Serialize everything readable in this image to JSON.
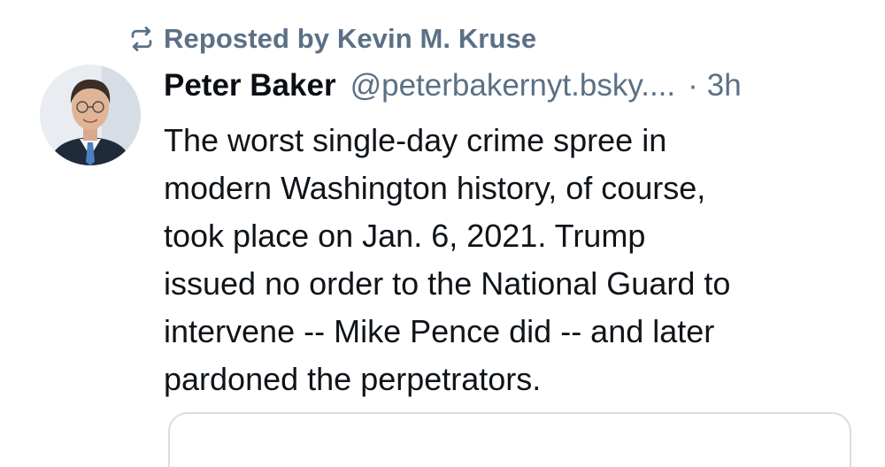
{
  "repost": {
    "label": "Reposted by Kevin M. Kruse",
    "icon": "repost-icon"
  },
  "post": {
    "author_name": "Peter Baker",
    "author_handle": "@peterbakernyt.bsky....",
    "separator": "·",
    "timestamp": "3h",
    "avatar_icon": "avatar-photo",
    "text_lines": [
      "The worst single-day crime spree in",
      "modern Washington history, of course,",
      "took place on Jan. 6, 2021. Trump",
      "issued no order to the National Guard to",
      "intervene -- Mike Pence did -- and later",
      "pardoned the perpetrators."
    ]
  },
  "colors": {
    "muted": "#5b7085",
    "text": "#0f1419",
    "card_border": "#d9dee4"
  }
}
